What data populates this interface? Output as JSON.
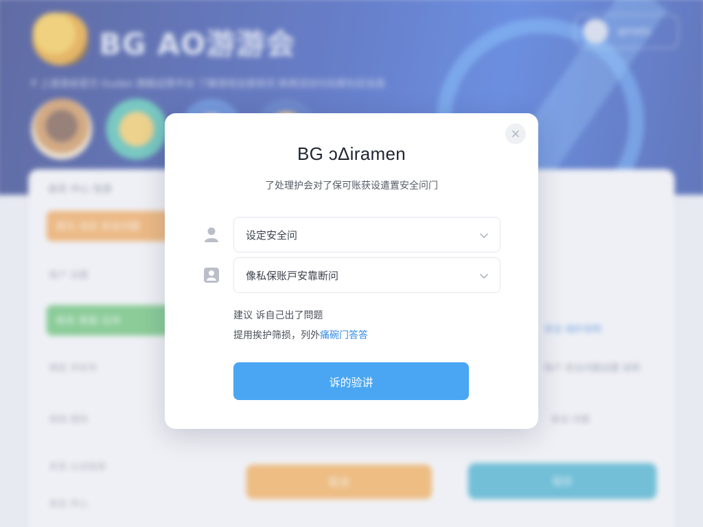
{
  "background": {
    "logo_text": "BG AO游游会",
    "tagline": "P 上游游会官方 Gudan 旗舰运营平台 了解游戏全部资讯 新闻活动与玩家社区信息",
    "user_name": "qrnets",
    "card_title": "会员 中心 信息",
    "orange_button": "提交 设定 安全问题",
    "green_button": "联系 客服 支持",
    "rows": [
      "账户 设置",
      "绑定 手机号",
      "修改 密码",
      "实名 认证信息",
      "安全 中心"
    ],
    "right_texts": [
      "安全 保护说明",
      "账户 安全问题设置 说明",
      "安全 问答"
    ],
    "bottom_orange": "取消",
    "bottom_teal": "保存"
  },
  "modal": {
    "title": "BG ͻΔiramen",
    "subtitle": "了处理护会对了保可账获设遣置安全问门",
    "select1": {
      "placeholder": "设定安全问"
    },
    "select2": {
      "placeholder": "像私保账戸安靠断问"
    },
    "hint1": "建议 诉自己出了問题",
    "hint2_prefix": "提用挨护筛损，列外",
    "hint2_link": "痛碗门答答",
    "submit_label": "诉的验讲"
  },
  "colors": {
    "accent": "#4aa6f2",
    "link": "#2f8ae6",
    "header_bg": "#2344b0"
  }
}
